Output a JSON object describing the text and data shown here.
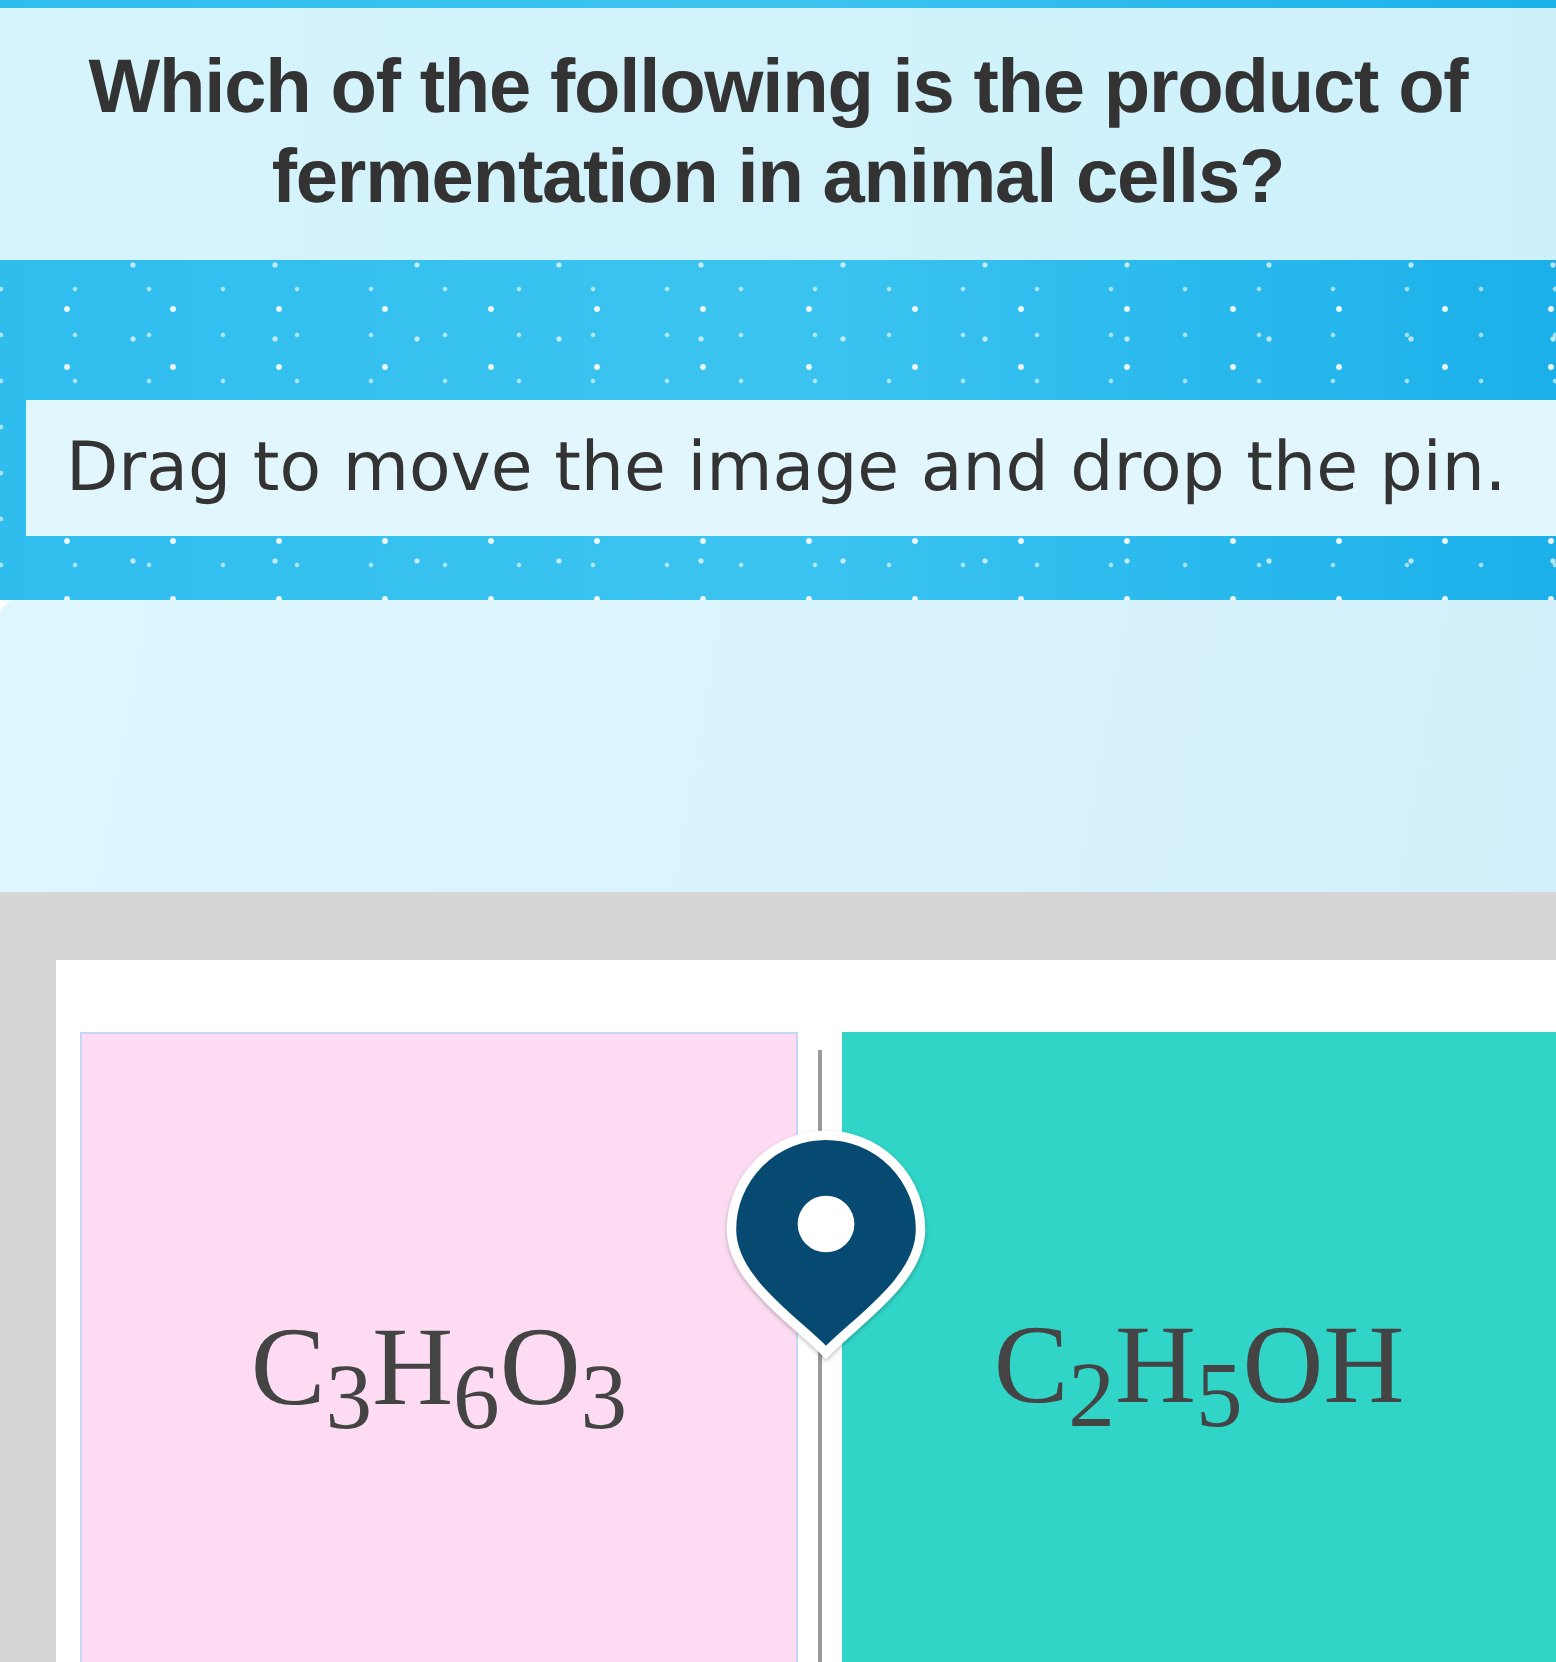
{
  "question": "Which of the following is the product of fermentation in animal cells?",
  "instruction": "Drag to move the image and drop the pin.",
  "options": [
    {
      "formula": "C$_{3}$H$_{6}$O$_{3}$",
      "color": "#fddcf3"
    },
    {
      "formula": "C$_{2}$H$_{5}$OH",
      "color": "#30d5c8"
    }
  ]
}
